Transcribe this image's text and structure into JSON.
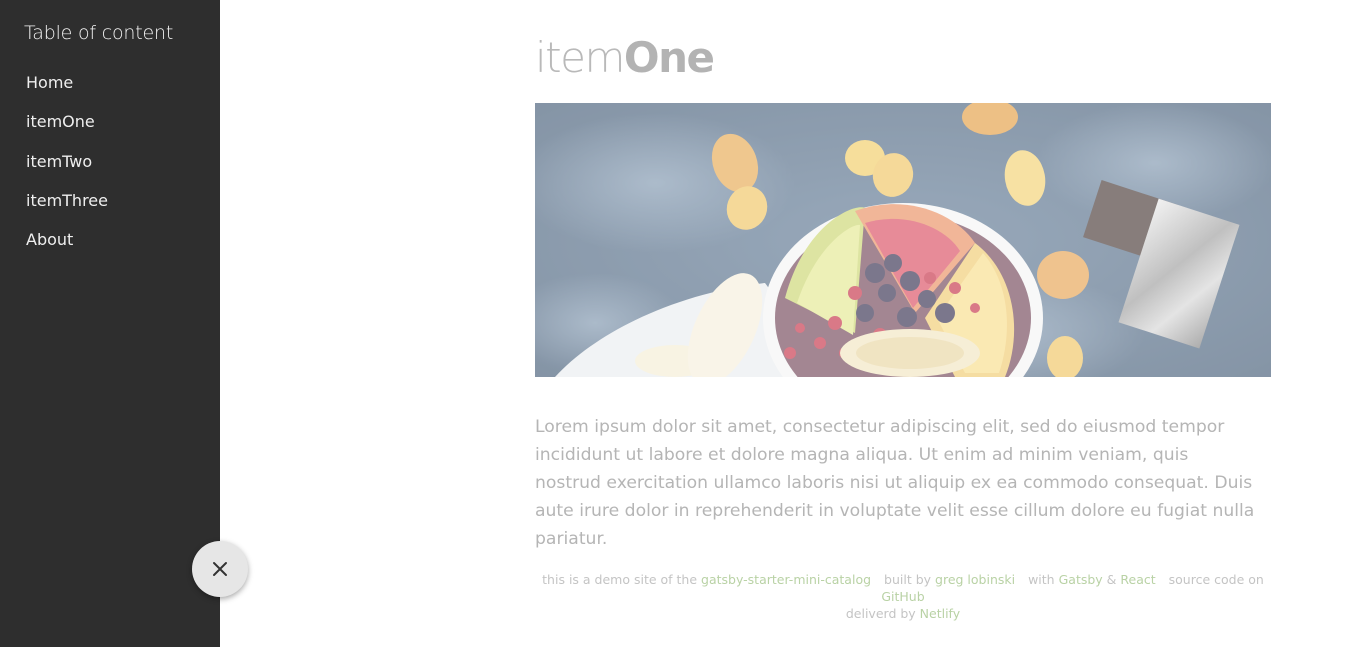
{
  "sidebar": {
    "title": "Table of content",
    "items": [
      {
        "label": "Home"
      },
      {
        "label": "itemOne"
      },
      {
        "label": "itemTwo"
      },
      {
        "label": "itemThree"
      },
      {
        "label": "About"
      }
    ]
  },
  "close_button": {
    "icon": "close-icon"
  },
  "page": {
    "title_light": "item",
    "title_bold": "One",
    "hero_image": "fruit-bowl-image",
    "body": "Lorem ipsum dolor sit amet, consectetur adipiscing elit, sed do eiusmod tempor incididunt ut labore et dolore magna aliqua. Ut enim ad minim veniam, quis nostrud exercitation ullamco laboris nisi ut aliquip ex ea commodo consequat. Duis aute irure dolor in reprehenderit in voluptate velit esse cillum dolore eu fugiat nulla pariatur."
  },
  "footer": {
    "demo_text": "this is a demo site of the",
    "demo_link": "gatsby-starter-mini-catalog",
    "built_text": "built by",
    "author_link": "greg lobinski",
    "with_text": "with",
    "gatsby_link": "Gatsby",
    "amp": "&",
    "react_link": "React",
    "source_text": "source code on",
    "github_link": "GitHub",
    "delivered_text": "deliverd by",
    "netlify_link": "Netlify"
  },
  "colors": {
    "sidebar_bg": "#2e2e2e",
    "link_green": "#b9d2a5",
    "muted_text": "#b5b5b5"
  }
}
